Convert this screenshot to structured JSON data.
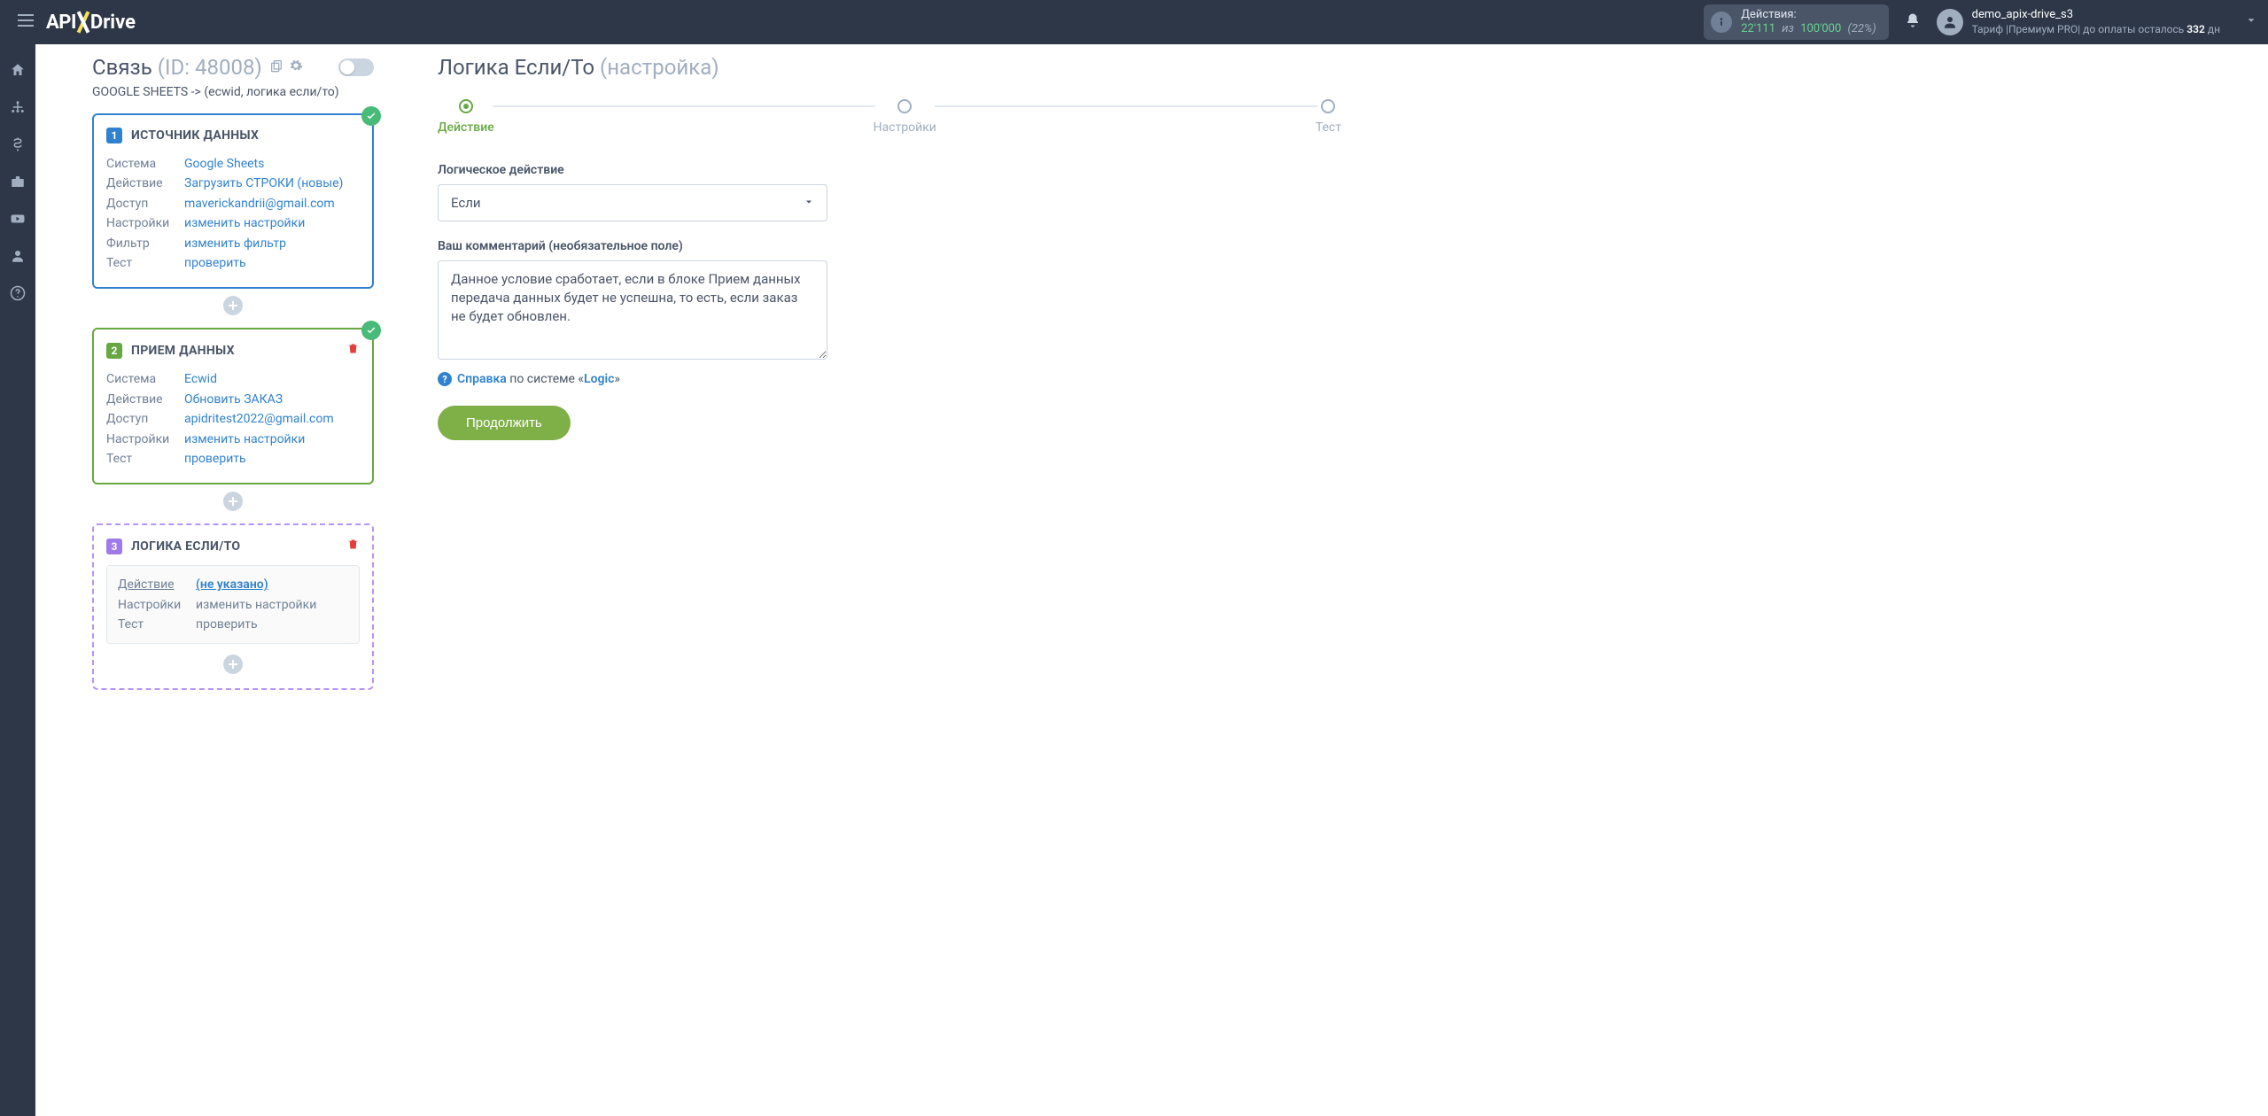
{
  "header": {
    "logo_a": "API",
    "logo_b": "Drive",
    "actions_label": "Действия:",
    "actions_current": "22'111",
    "actions_sep": "из",
    "actions_total": "100'000",
    "actions_pct": "(22%)",
    "user_name": "demo_apix-drive_s3",
    "user_tariff_prefix": "Тариф |Премиум PRO|  до оплаты осталось ",
    "user_days": "332",
    "user_days_suffix": " дн"
  },
  "conn": {
    "title": "Связь",
    "id": "(ID: 48008)",
    "sub": "GOOGLE SHEETS -> (ecwid, логика если/то)"
  },
  "card1": {
    "title": "ИСТОЧНИК ДАННЫХ",
    "rows": {
      "system_k": "Система",
      "system_v": "Google Sheets",
      "action_k": "Действие",
      "action_v": "Загрузить СТРОКИ (новые)",
      "access_k": "Доступ",
      "access_v": "maverickandrii@gmail.com",
      "settings_k": "Настройки",
      "settings_v": "изменить настройки",
      "filter_k": "Фильтр",
      "filter_v": "изменить фильтр",
      "test_k": "Тест",
      "test_v": "проверить"
    }
  },
  "card2": {
    "title": "ПРИЕМ ДАННЫХ",
    "rows": {
      "system_k": "Система",
      "system_v": "Ecwid",
      "action_k": "Действие",
      "action_v": "Обновить ЗАКАЗ",
      "access_k": "Доступ",
      "access_v": "apidritest2022@gmail.com",
      "settings_k": "Настройки",
      "settings_v": "изменить настройки",
      "test_k": "Тест",
      "test_v": "проверить"
    }
  },
  "card3": {
    "title": "ЛОГИКА ЕСЛИ/ТО",
    "rows": {
      "action_k": "Действие",
      "action_v": "(не указано)",
      "settings_k": "Настройки",
      "settings_v": "изменить настройки",
      "test_k": "Тест",
      "test_v": "проверить"
    }
  },
  "right": {
    "title": "Логика Если/То",
    "title_muted": "(настройка)",
    "step1": "Действие",
    "step2": "Настройки",
    "step3": "Тест",
    "fld_action": "Логическое действие",
    "select_value": "Если",
    "fld_comment": "Ваш комментарий (необязательное поле)",
    "comment_value": "Данное условие сработает, если в блоке Прием данных передача данных будет не успешна, то есть, если заказ не будет обновлен.",
    "help_a": "Справка",
    "help_b": " по системе «",
    "help_c": "Logic",
    "help_d": "»",
    "continue": "Продолжить"
  }
}
